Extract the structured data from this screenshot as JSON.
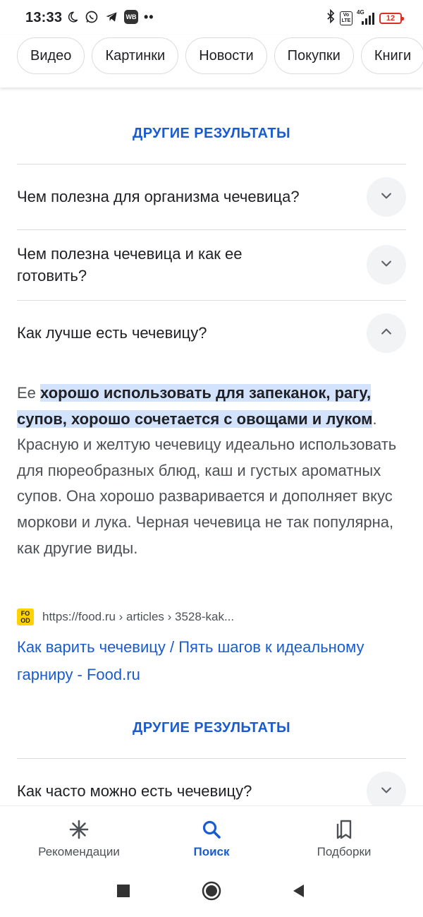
{
  "status_bar": {
    "time": "13:33",
    "wb_badge": "WB",
    "more": "••",
    "network": "4G",
    "volte": "Vo LTE",
    "battery": "12",
    "battery_color": "#d93025"
  },
  "chips": [
    "Видео",
    "Картинки",
    "Новости",
    "Покупки",
    "Книги"
  ],
  "section_title_top": "ДРУГИЕ РЕЗУЛЬТАТЫ",
  "questions": [
    {
      "text": "Чем полезна для организма чечевица?",
      "expanded": false,
      "icon": "chevron-down-icon"
    },
    {
      "text": "Чем полезна чечевица и как ее готовить?",
      "expanded": false,
      "icon": "chevron-down-icon"
    },
    {
      "text": "Как лучше есть чечевицу?",
      "expanded": true,
      "icon": "chevron-up-icon"
    }
  ],
  "answer": {
    "prefix": "Ее ",
    "highlight": "хорошо использовать для запеканок, рагу, супов, хорошо сочетается с овощами и луком",
    "suffix": ". Красную и желтую чечевицу идеально использовать для пюреобразных блюд, каш и густых ароматных супов. Она хорошо разваривается и дополняет вкус моркови и лука. Черная чечевица не так популярна, как другие виды."
  },
  "source": {
    "favicon_text": "FO OD",
    "url": "https://food.ru › articles › 3528-kak...",
    "title": "Как варить чечевицу / Пять шагов к идеальному гарниру - Food.ru"
  },
  "section_title_bottom": "ДРУГИЕ РЕЗУЛЬТАТЫ",
  "question_bottom": {
    "text": "Как часто можно есть чечевицу?",
    "expanded": false,
    "icon": "chevron-down-icon"
  },
  "bottom_nav": [
    {
      "label": "Рекомендации",
      "icon": "asterisk-icon",
      "active": false
    },
    {
      "label": "Поиск",
      "icon": "search-icon",
      "active": true
    },
    {
      "label": "Подборки",
      "icon": "collections-icon",
      "active": false
    }
  ],
  "colors": {
    "accent": "#1a5ccf",
    "highlight_bg": "#d3e3fd",
    "text": "#202124",
    "secondary_text": "#4d5156"
  }
}
